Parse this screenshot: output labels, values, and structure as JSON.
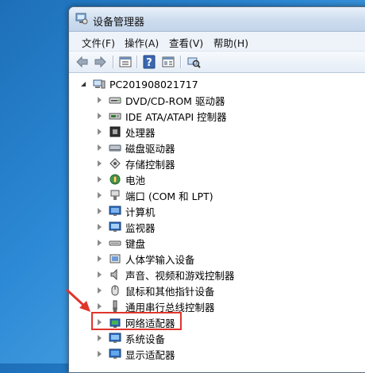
{
  "window": {
    "title": "设备管理器",
    "icon": "device-manager-icon"
  },
  "menu": [
    "文件(F)",
    "操作(A)",
    "查看(V)",
    "帮助(H)"
  ],
  "toolbar": [
    "back-arrow-icon",
    "forward-arrow-icon",
    "properties-panel-icon",
    "help-icon",
    "show-view-icon",
    "scan-hardware-icon"
  ],
  "tree": {
    "root": {
      "label": "PC201908021717",
      "icon": "computer-icon",
      "expanded": true
    },
    "items": [
      {
        "label": "DVD/CD-ROM 驱动器",
        "icon": "dvd-drive-icon"
      },
      {
        "label": "IDE ATA/ATAPI 控制器",
        "icon": "ide-controller-icon"
      },
      {
        "label": "处理器",
        "icon": "processor-icon"
      },
      {
        "label": "磁盘驱动器",
        "icon": "disk-drive-icon"
      },
      {
        "label": "存储控制器",
        "icon": "storage-controller-icon"
      },
      {
        "label": "电池",
        "icon": "battery-icon"
      },
      {
        "label": "端口 (COM 和 LPT)",
        "icon": "port-icon"
      },
      {
        "label": "计算机",
        "icon": "computer-monitor-icon"
      },
      {
        "label": "监视器",
        "icon": "monitor-icon"
      },
      {
        "label": "键盘",
        "icon": "keyboard-icon"
      },
      {
        "label": "人体学输入设备",
        "icon": "hid-icon"
      },
      {
        "label": "声音、视频和游戏控制器",
        "icon": "sound-icon"
      },
      {
        "label": "鼠标和其他指针设备",
        "icon": "mouse-icon"
      },
      {
        "label": "通用串行总线控制器",
        "icon": "usb-icon"
      },
      {
        "label": "网络适配器",
        "icon": "network-adapter-icon"
      },
      {
        "label": "系统设备",
        "icon": "system-device-icon"
      },
      {
        "label": "显示适配器",
        "icon": "display-adapter-icon"
      }
    ]
  },
  "annotation": {
    "highlighted_item": "网络适配器",
    "highlight_color": "#e0352b"
  }
}
